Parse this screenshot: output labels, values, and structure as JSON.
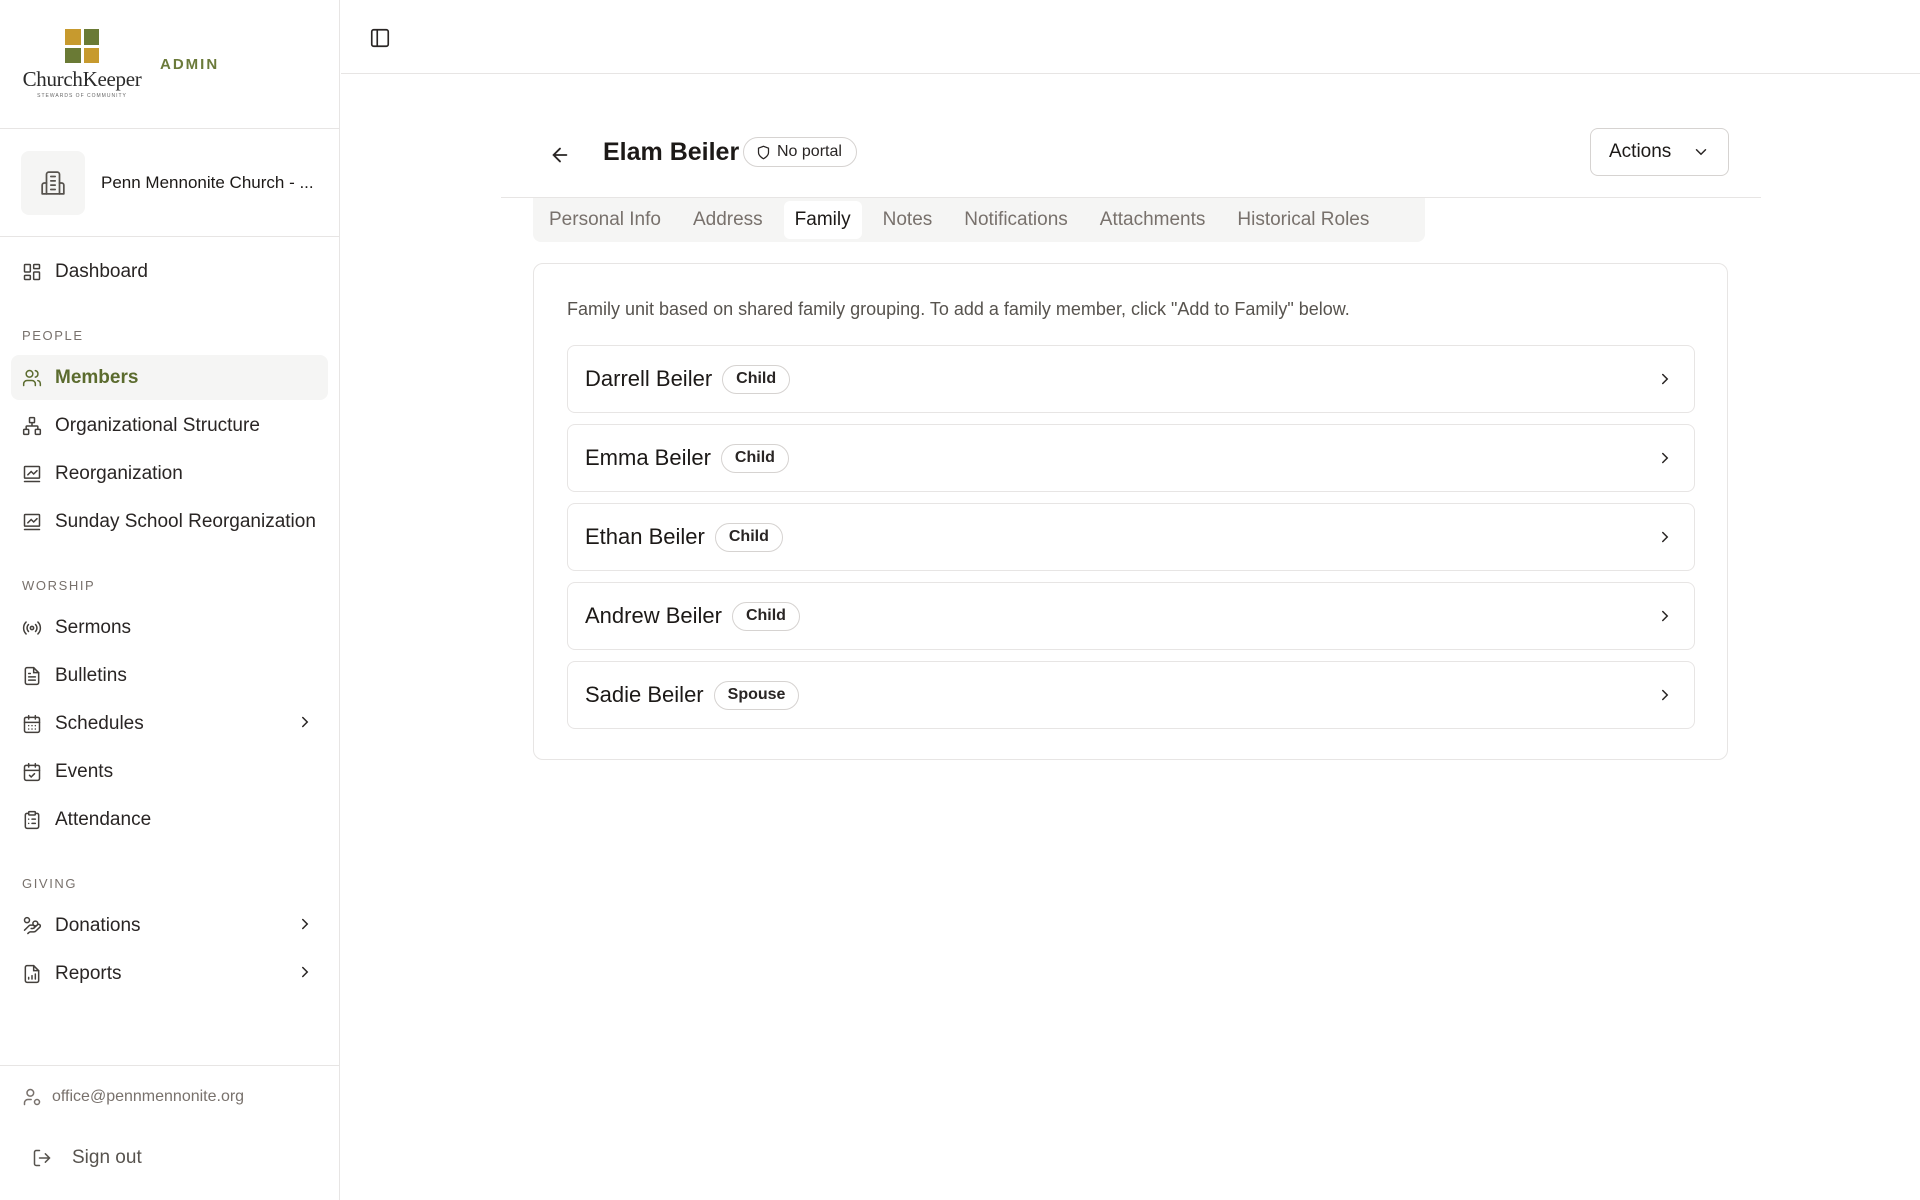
{
  "brand": {
    "logo_text": "ChurchKeeper",
    "logo_sub": "STEWARDS OF COMMUNITY",
    "admin_label": "ADMIN"
  },
  "org": {
    "name": "Penn Mennonite Church - ..."
  },
  "nav": {
    "dashboard": "Dashboard",
    "people_label": "PEOPLE",
    "members": "Members",
    "org_structure": "Organizational Structure",
    "reorganization": "Reorganization",
    "sunday_school": "Sunday School Reorganization",
    "worship_label": "WORSHIP",
    "sermons": "Sermons",
    "bulletins": "Bulletins",
    "schedules": "Schedules",
    "events": "Events",
    "attendance": "Attendance",
    "giving_label": "GIVING",
    "donations": "Donations",
    "reports": "Reports"
  },
  "footer": {
    "email": "office@pennmennonite.org",
    "sign_out": "Sign out"
  },
  "header": {
    "name": "Elam Beiler",
    "portal_status": "No portal",
    "actions_label": "Actions"
  },
  "tabs": [
    "Personal Info",
    "Address",
    "Family",
    "Notes",
    "Notifications",
    "Attachments",
    "Historical Roles"
  ],
  "active_tab": "Family",
  "family": {
    "description": "Family unit based on shared family grouping. To add a family member, click \"Add to Family\" below.",
    "members": [
      {
        "name": "Darrell Beiler",
        "role": "Child"
      },
      {
        "name": "Emma Beiler",
        "role": "Child"
      },
      {
        "name": "Ethan Beiler",
        "role": "Child"
      },
      {
        "name": "Andrew Beiler",
        "role": "Child"
      },
      {
        "name": "Sadie Beiler",
        "role": "Spouse"
      }
    ]
  },
  "colors": {
    "accent": "#5b6b2e",
    "border": "#e7e5e4",
    "muted_bg": "#f5f5f4"
  }
}
